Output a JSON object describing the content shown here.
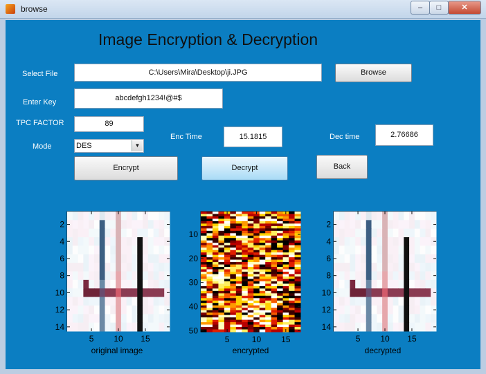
{
  "window": {
    "title": "browse"
  },
  "heading": "Image Encryption & Decryption",
  "form": {
    "select_file_label": "Select File",
    "file_path": "C:\\Users\\Mira\\Desktop\\ji.JPG",
    "browse_label": "Browse",
    "enter_key_label": "Enter Key",
    "key_value": "abcdefgh1234!@#$",
    "tpc_label": "TPC FACTOR",
    "tpc_value": "89",
    "mode_label": "Mode",
    "mode_value": "DES",
    "enc_time_label": "Enc Time",
    "enc_time_value": "15.1815",
    "dec_time_label": "Dec time",
    "dec_time_value": "2.76686",
    "encrypt_label": "Encrypt",
    "decrypt_label": "Decrypt",
    "back_label": "Back"
  },
  "axes": [
    {
      "xlabel": "original image",
      "yticks": [
        "2",
        "4",
        "6",
        "8",
        "10",
        "12",
        "14"
      ],
      "xticks": [
        "5",
        "10",
        "15"
      ]
    },
    {
      "xlabel": "encrypted",
      "yticks": [
        "10",
        "20",
        "30",
        "40",
        "50"
      ],
      "xticks": [
        "5",
        "10",
        "15"
      ]
    },
    {
      "xlabel": "decrypted",
      "yticks": [
        "2",
        "4",
        "6",
        "8",
        "10",
        "12",
        "14"
      ],
      "xticks": [
        "5",
        "10",
        "15"
      ]
    }
  ],
  "colors": {
    "panel": "#0b7ec2",
    "label_text": "#ffffff"
  }
}
